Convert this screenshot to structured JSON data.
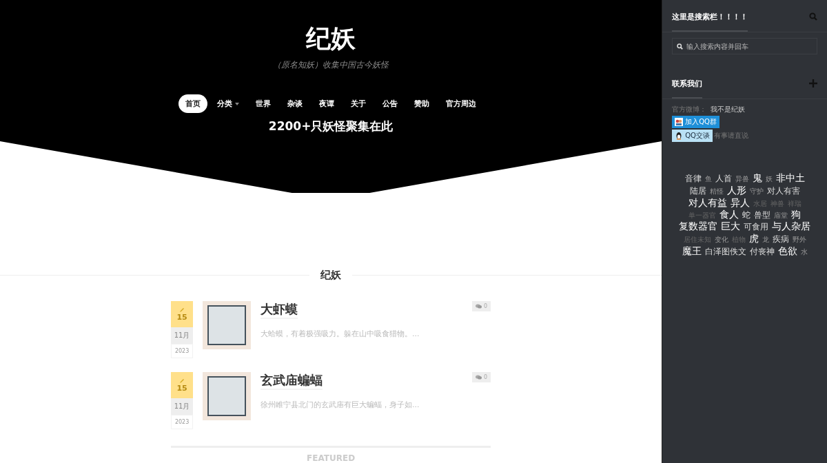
{
  "site": {
    "title": "纪妖",
    "subtitle": "（原名知妖）收集中国古今妖怪",
    "tagline": "2200+只妖怪聚集在此"
  },
  "nav": [
    {
      "label": "首页",
      "selected": true,
      "has_dropdown": false
    },
    {
      "label": "分类",
      "selected": false,
      "has_dropdown": true
    },
    {
      "label": "世界",
      "selected": false,
      "has_dropdown": false
    },
    {
      "label": "杂谈",
      "selected": false,
      "has_dropdown": false
    },
    {
      "label": "夜谭",
      "selected": false,
      "has_dropdown": false
    },
    {
      "label": "关于",
      "selected": false,
      "has_dropdown": false
    },
    {
      "label": "公告",
      "selected": false,
      "has_dropdown": false
    },
    {
      "label": "赞助",
      "selected": false,
      "has_dropdown": false
    },
    {
      "label": "官方周边",
      "selected": false,
      "has_dropdown": false
    }
  ],
  "section_title": "纪妖",
  "posts": [
    {
      "day": "15",
      "month": "11月",
      "year": "2023",
      "title": "大虾蟆",
      "excerpt": "大蛤蟆，有着极强吸力。躲在山中吸食猎物。...",
      "comments": "0"
    },
    {
      "day": "15",
      "month": "11月",
      "year": "2023",
      "title": "玄武庙蝙蝠",
      "excerpt": "徐州睢宁县北门的玄武庙有巨大蝙蝠，身子如...",
      "comments": "0"
    }
  ],
  "featured_label": "FEATURED",
  "sidebar": {
    "search_title": "这里是搜索栏！！！！",
    "search_placeholder": "输入搜索内容并回车",
    "contact_title": "联系我们",
    "weibo_label": "官方微博：",
    "weibo_name": "我不是纪妖",
    "qq_group_button": "加入QQ群",
    "qq_chat_button": "QQ交谈",
    "qq_note": "有事请直说",
    "tags": [
      {
        "label": "音律",
        "kind": "mid"
      },
      {
        "label": "鱼",
        "kind": "dim"
      },
      {
        "label": "人首",
        "kind": "mid"
      },
      {
        "label": "异兽",
        "kind": "dim"
      },
      {
        "label": "鬼",
        "kind": "bright"
      },
      {
        "label": "妖",
        "kind": "dim"
      },
      {
        "label": "非中土",
        "kind": "bright"
      },
      {
        "label": "陆居",
        "kind": "mid"
      },
      {
        "label": "精怪",
        "kind": "dim"
      },
      {
        "label": "人形",
        "kind": "bright"
      },
      {
        "label": "守护",
        "kind": "dim"
      },
      {
        "label": "对人有害",
        "kind": "mid"
      },
      {
        "label": "对人有益",
        "kind": "bright"
      },
      {
        "label": "异人",
        "kind": "bright"
      },
      {
        "label": "水居",
        "kind": "faint"
      },
      {
        "label": "神兽",
        "kind": "faint"
      },
      {
        "label": "祥瑞",
        "kind": "faint"
      },
      {
        "label": "单一器官",
        "kind": "faint"
      },
      {
        "label": "食人",
        "kind": "bright"
      },
      {
        "label": "蛇",
        "kind": "mid"
      },
      {
        "label": "兽型",
        "kind": "mid"
      },
      {
        "label": "庙堂",
        "kind": "dim"
      },
      {
        "label": "狗",
        "kind": "bright"
      },
      {
        "label": "复数器官",
        "kind": "bright"
      },
      {
        "label": "巨大",
        "kind": "bright"
      },
      {
        "label": "可食用",
        "kind": "mid"
      },
      {
        "label": "与人杂居",
        "kind": "bright"
      },
      {
        "label": "居住未知",
        "kind": "faint"
      },
      {
        "label": "变化",
        "kind": "dim"
      },
      {
        "label": "植物",
        "kind": "faint"
      },
      {
        "label": "虎",
        "kind": "bright"
      },
      {
        "label": "龙",
        "kind": "dim"
      },
      {
        "label": "疾病",
        "kind": "mid"
      },
      {
        "label": "野外",
        "kind": "dim"
      },
      {
        "label": "魔王",
        "kind": "bright"
      },
      {
        "label": "白泽图佚文",
        "kind": "mid"
      },
      {
        "label": "付丧神",
        "kind": "mid"
      },
      {
        "label": "色欲",
        "kind": "bright"
      },
      {
        "label": "水",
        "kind": "dim"
      }
    ]
  }
}
